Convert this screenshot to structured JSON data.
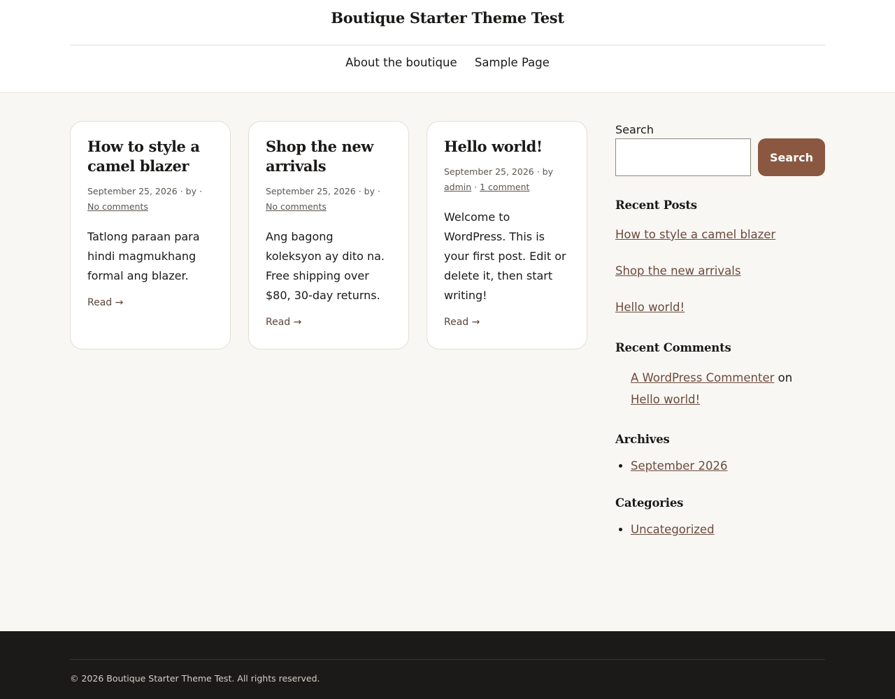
{
  "site": {
    "title": "Boutique Starter Theme Test"
  },
  "nav": {
    "items": [
      {
        "label": "About the boutique"
      },
      {
        "label": "Sample Page"
      }
    ]
  },
  "posts": [
    {
      "title": "How to style a camel blazer",
      "date": "September 25, 2026",
      "meta_sep": "· by ·",
      "comments": "No comments",
      "excerpt": "Tatlong paraan para hindi magmukhang formal ang blazer.",
      "read": "Read →"
    },
    {
      "title": "Shop the new arrivals",
      "date": "September 25, 2026",
      "meta_sep": "· by ·",
      "comments": "No comments",
      "excerpt": "Ang bagong koleksyon ay dito na. Free shipping over $80, 30-day returns.",
      "read": "Read →"
    },
    {
      "title": "Hello world!",
      "date": "September 25, 2026",
      "meta_sep": "· by",
      "author": "admin",
      "author_sep": "·",
      "comments": "1 comment",
      "excerpt": "Welcome to WordPress. This is your first post. Edit or delete it, then start writing!",
      "read": "Read →"
    }
  ],
  "sidebar": {
    "search": {
      "label": "Search",
      "button": "Search",
      "value": ""
    },
    "recent_posts": {
      "title": "Recent Posts",
      "items": [
        "How to style a camel blazer",
        "Shop the new arrivals",
        "Hello world!"
      ]
    },
    "recent_comments": {
      "title": "Recent Comments",
      "author": "A WordPress Commenter",
      "on": "on",
      "post": "Hello world!"
    },
    "archives": {
      "title": "Archives",
      "items": [
        "September 2026"
      ]
    },
    "categories": {
      "title": "Categories",
      "items": [
        "Uncategorized"
      ]
    }
  },
  "footer": {
    "text": "© 2026 Boutique Starter Theme Test. All rights reserved."
  },
  "colors": {
    "accent": "#8a5840",
    "link": "#6b4a3c",
    "footer_bg": "#1c1a18",
    "page_bg": "#f9f7f4"
  }
}
